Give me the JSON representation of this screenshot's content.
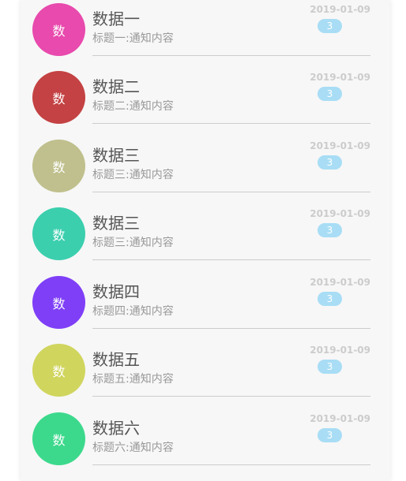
{
  "items": [
    {
      "title": "数据一",
      "subtitle": "标题一:通知内容",
      "date": "2019-01-09",
      "badge": "3",
      "avatar_text": "数",
      "avatar_color": "#e84aad"
    },
    {
      "title": "数据二",
      "subtitle": "标题二:通知内容",
      "date": "2019-01-09",
      "badge": "3",
      "avatar_text": "数",
      "avatar_color": "#c44243"
    },
    {
      "title": "数据三",
      "subtitle": "标题三:通知内容",
      "date": "2019-01-09",
      "badge": "3",
      "avatar_text": "数",
      "avatar_color": "#bfc08d"
    },
    {
      "title": "数据三",
      "subtitle": "标题三:通知内容",
      "date": "2019-01-09",
      "badge": "3",
      "avatar_text": "数",
      "avatar_color": "#3bcfae"
    },
    {
      "title": "数据四",
      "subtitle": "标题四:通知内容",
      "date": "2019-01-09",
      "badge": "3",
      "avatar_text": "数",
      "avatar_color": "#7f3ff7"
    },
    {
      "title": "数据五",
      "subtitle": "标题五:通知内容",
      "date": "2019-01-09",
      "badge": "3",
      "avatar_text": "数",
      "avatar_color": "#d0d55e"
    },
    {
      "title": "数据六",
      "subtitle": "标题六:通知内容",
      "date": "2019-01-09",
      "badge": "3",
      "avatar_text": "数",
      "avatar_color": "#3cd98c"
    }
  ]
}
